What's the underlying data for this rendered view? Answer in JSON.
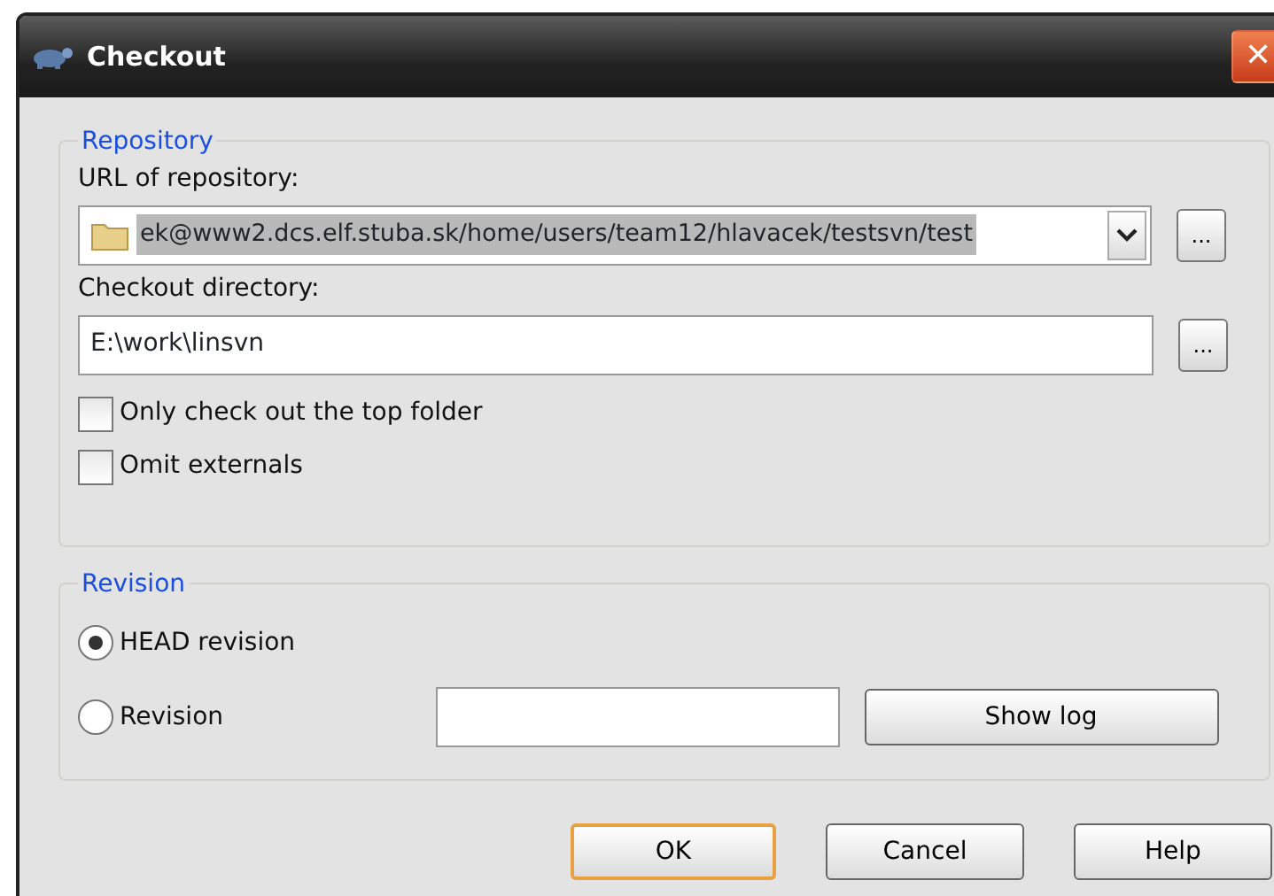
{
  "window": {
    "title": "Checkout",
    "close": "✕"
  },
  "repository": {
    "legend": "Repository",
    "url_label": "URL of repository:",
    "url_value": "ek@www2.dcs.elf.stuba.sk/home/users/team12/hlavacek/testsvn/test",
    "url_browse": "...",
    "dir_label": "Checkout directory:",
    "dir_value": "E:\\work\\linsvn",
    "dir_browse": "...",
    "options": [
      {
        "label": "Only check out the top folder",
        "checked": false
      },
      {
        "label": "Omit externals",
        "checked": false
      }
    ]
  },
  "revision": {
    "legend": "Revision",
    "choices": [
      {
        "label": "HEAD revision",
        "selected": true
      },
      {
        "label": "Revision",
        "selected": false
      }
    ],
    "show_log": "Show log"
  },
  "buttons": [
    {
      "label": "OK",
      "default": true
    },
    {
      "label": "Cancel",
      "default": false
    },
    {
      "label": "Help",
      "default": false
    }
  ]
}
